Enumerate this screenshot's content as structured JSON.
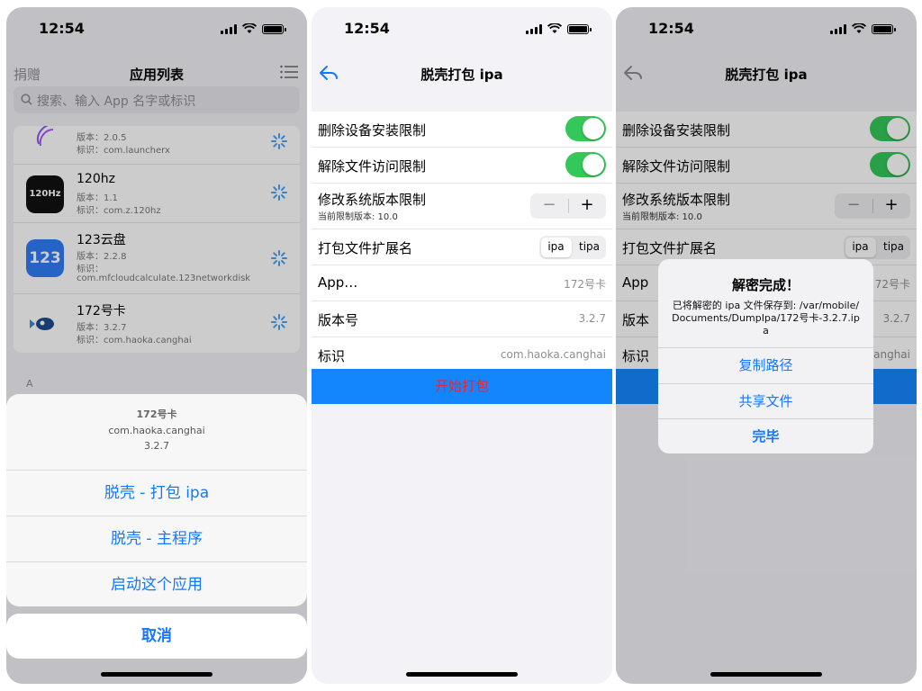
{
  "status": {
    "time": "12:54"
  },
  "screen1": {
    "nav": {
      "left": "捐赠",
      "title": "应用列表"
    },
    "search_placeholder": "搜索、输入 App 名字或标识",
    "apps": [
      {
        "name": "",
        "version": "版本：2.0.5",
        "bundle": "标识：com.launcherx",
        "bundle2": ""
      },
      {
        "name": "120hz",
        "version": "版本：1.1",
        "bundle": "标识：com.z.120hz",
        "bundle2": "",
        "icon_text": "120Hz"
      },
      {
        "name": "123云盘",
        "version": "版本：2.2.8",
        "bundle": "标识：",
        "bundle2": "com.mfcloudcalculate.123networkdisk",
        "icon_text": "123"
      },
      {
        "name": "172号卡",
        "version": "版本：3.2.7",
        "bundle": "标识：com.haoka.canghai",
        "bundle2": ""
      }
    ],
    "section_index": "A",
    "sheet": {
      "title": "172号卡",
      "bundle": "com.haoka.canghai",
      "version": "3.2.7",
      "options": [
        "脱壳 - 打包 ipa",
        "脱壳 - 主程序",
        "启动这个应用"
      ],
      "cancel": "取消"
    }
  },
  "screen2": {
    "title": "脱壳打包 ipa",
    "rows": {
      "remove_install_limit": "删除设备安装限制",
      "remove_file_limit": "解除文件访问限制",
      "modify_version_limit": "修改系统版本限制",
      "current_limit_note": "当前限制版本: 10.0",
      "stepper_minus": "−",
      "stepper_plus": "+",
      "ext_label": "打包文件扩展名",
      "ext_options": [
        "ipa",
        "tipa"
      ],
      "app_label": "App…",
      "app_value": "172号卡",
      "version_label": "版本号",
      "version_value": "3.2.7",
      "id_label": "标识",
      "id_value": "com.haoka.canghai"
    },
    "start_button": "开始打包"
  },
  "screen3": {
    "app_label": "App",
    "app_value": "72号卡",
    "version_label": "版本",
    "id_value": "canghai",
    "alert": {
      "title": "解密完成！",
      "message": "已将解密的 ipa 文件保存到: /var/mobile/Documents/DumpIpa/172号卡-3.2.7.ipa",
      "buttons": [
        "复制路径",
        "共享文件",
        "完毕"
      ]
    }
  },
  "colors": {
    "accent": "#1677ff",
    "toggle_on": "#34c759",
    "start_bg": "#1486fd",
    "start_text": "#e8243c"
  }
}
